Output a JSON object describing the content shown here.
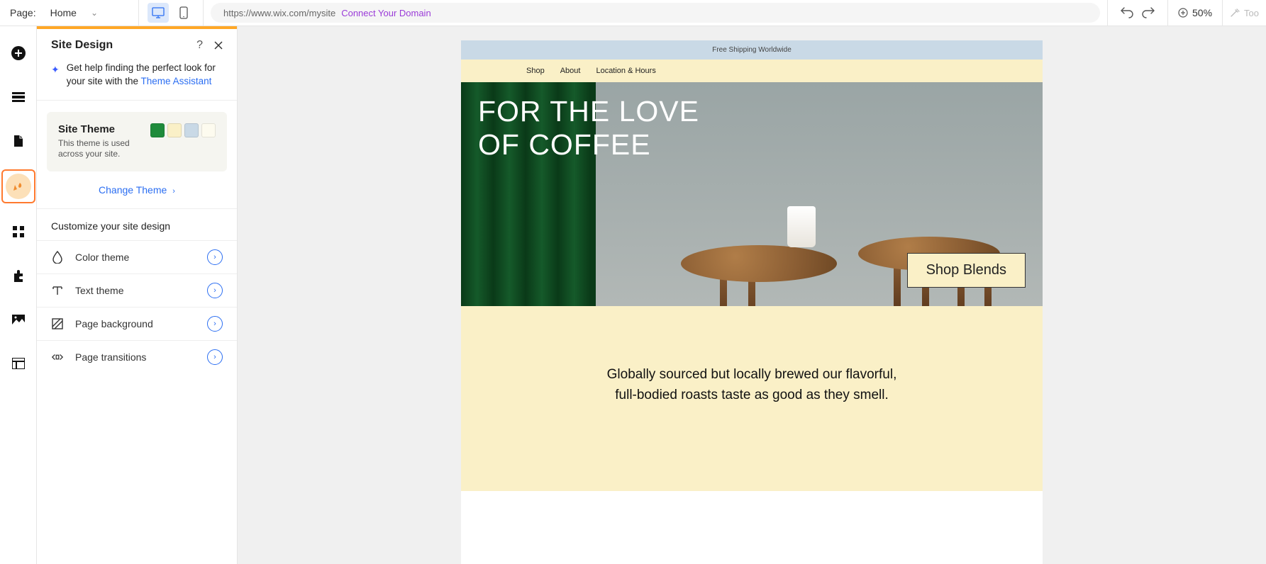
{
  "topbar": {
    "page_label": "Page:",
    "page_value": "Home",
    "url": "https://www.wix.com/mysite",
    "connect_domain": "Connect Your Domain",
    "zoom": "50%",
    "tools": "Too"
  },
  "panel": {
    "title": "Site Design",
    "assist_text_1": "Get help finding the perfect look for your site with the ",
    "assist_link": "Theme Assistant",
    "theme_title": "Site Theme",
    "theme_desc": "This theme is used across your site.",
    "change_theme": "Change Theme",
    "customize_heading": "Customize your site design",
    "colors": {
      "c1": "#1f8b3b",
      "c2": "#faf0c7",
      "c3": "#c9d9e6",
      "c4": "#fdfbef"
    },
    "options": [
      {
        "label": "Color theme"
      },
      {
        "label": "Text theme"
      },
      {
        "label": "Page background"
      },
      {
        "label": "Page transitions"
      }
    ]
  },
  "site": {
    "announcement": "Free Shipping Worldwide",
    "nav": [
      "Shop",
      "About",
      "Location & Hours"
    ],
    "hero_line1": "FOR THE LOVE",
    "hero_line2": "OF COFFEE",
    "shop_button": "Shop Blends",
    "tagline": "Globally sourced but locally brewed our flavorful, full-bodied roasts taste as good as they smell."
  }
}
